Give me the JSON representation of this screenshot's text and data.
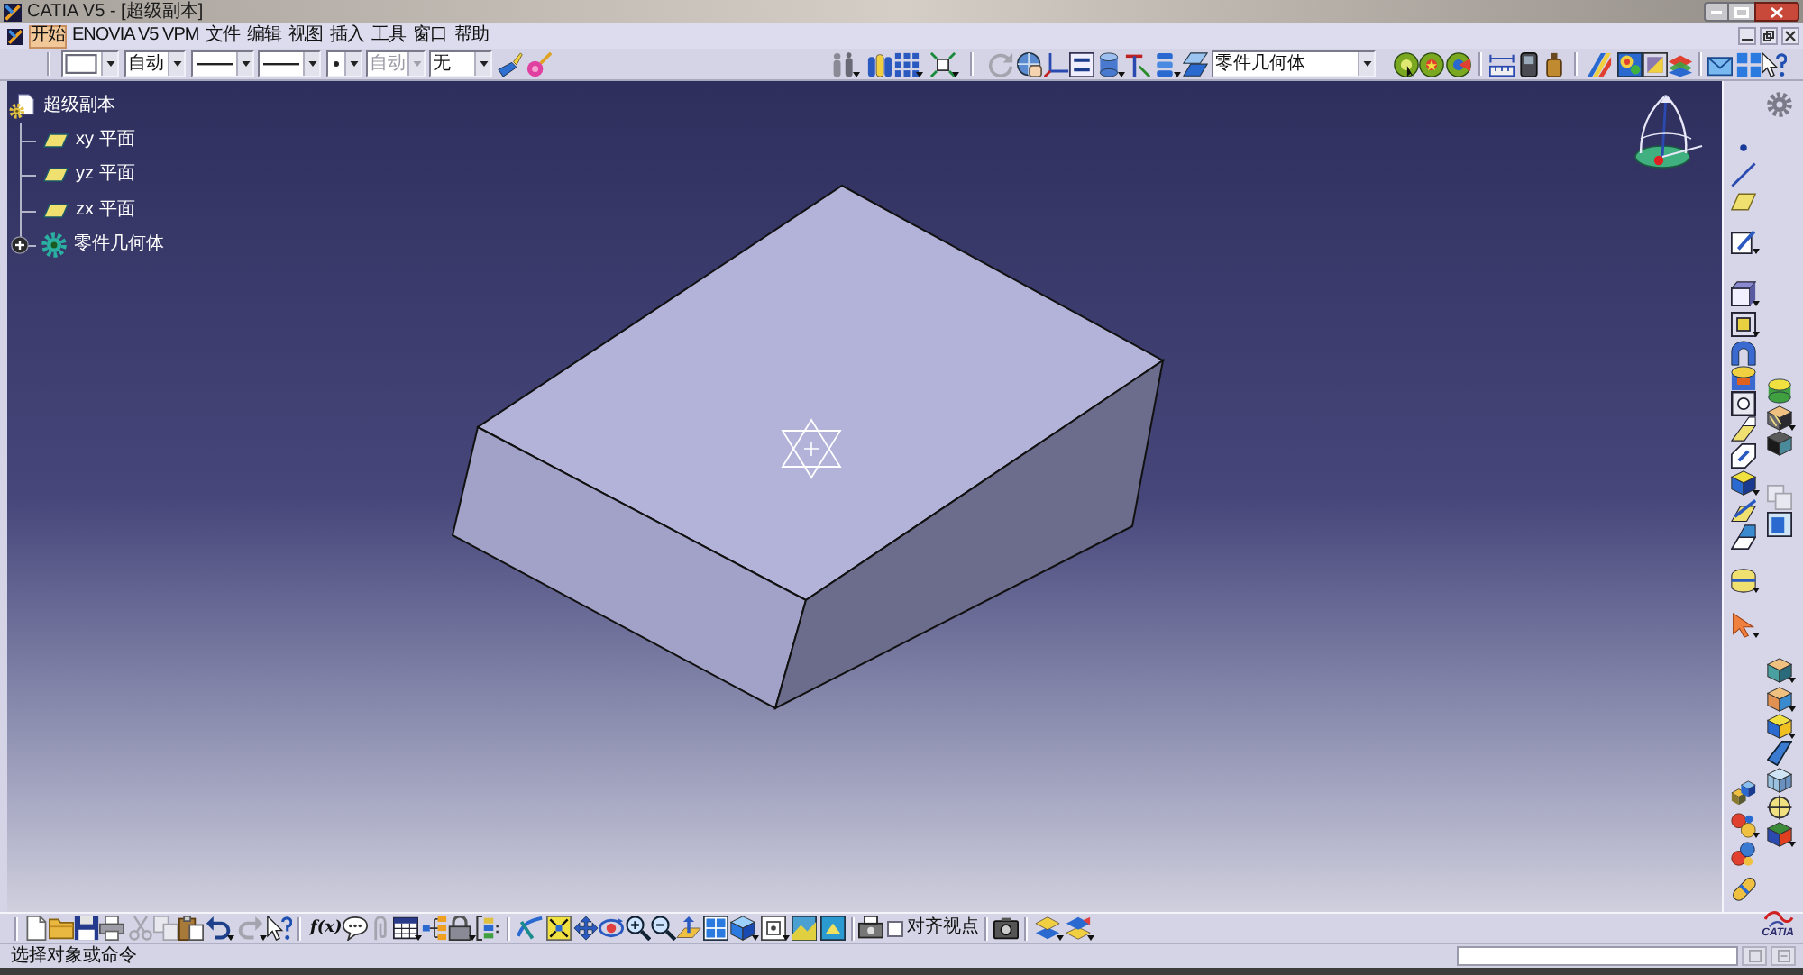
{
  "window": {
    "title": "CATIA V5 - [超级副本]"
  },
  "menu_bar": {
    "items": [
      {
        "label": "开始",
        "selected": true
      },
      {
        "label": "ENOVIA V5 VPM",
        "selected": false
      },
      {
        "label": "文件",
        "selected": false
      },
      {
        "label": "编辑",
        "selected": false
      },
      {
        "label": "视图",
        "selected": false
      },
      {
        "label": "插入",
        "selected": false
      },
      {
        "label": "工具",
        "selected": false
      },
      {
        "label": "窗口",
        "selected": false
      },
      {
        "label": "帮助",
        "selected": false
      }
    ]
  },
  "format_toolbar": {
    "dropdowns": [
      {
        "kind": "color",
        "disabled": false
      },
      {
        "kind": "text",
        "value": "自动",
        "disabled": false
      },
      {
        "kind": "line",
        "disabled": false
      },
      {
        "kind": "line",
        "disabled": false
      },
      {
        "kind": "point",
        "disabled": false
      },
      {
        "kind": "text",
        "value": "自动",
        "disabled": true
      },
      {
        "kind": "text",
        "value": "无",
        "disabled": false
      }
    ]
  },
  "tools_toolbar": {
    "current_body": "零件几何体"
  },
  "specification_tree": {
    "label": "超级副本",
    "children": [
      {
        "label": "xy 平面",
        "kind": "plane"
      },
      {
        "label": "yz 平面",
        "kind": "plane"
      },
      {
        "label": "zx 平面",
        "kind": "plane"
      },
      {
        "label": "零件几何体",
        "kind": "body",
        "expanded": false
      }
    ]
  },
  "standard_toolbar": {
    "formula_label": "f(x)",
    "align_view": {
      "label": "对齐视点",
      "checked": false
    }
  },
  "logo": {
    "text": "CATIA"
  },
  "status_bar": {
    "prompt": "选择对象或命令"
  }
}
